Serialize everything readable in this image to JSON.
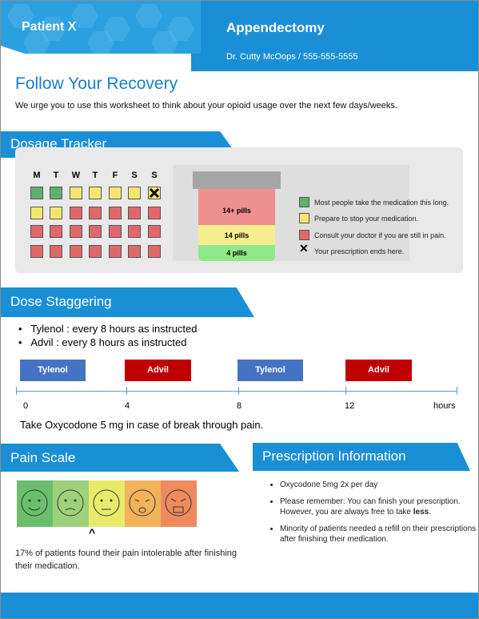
{
  "header": {
    "patient": "Patient X",
    "procedure": "Appendectomy",
    "doctor": "Dr. Cutty McOops / 555-555-5555"
  },
  "intro": {
    "title": "Follow Your Recovery",
    "text": "We urge you to use this worksheet to think about your opioid usage over the next few days/weeks."
  },
  "dosage": {
    "section_title": "Dosage Tracker",
    "days": [
      "M",
      "T",
      "W",
      "T",
      "F",
      "S",
      "S"
    ],
    "grid": [
      [
        "g",
        "g",
        "y",
        "y",
        "y",
        "y",
        "x"
      ],
      [
        "y",
        "y",
        "r",
        "r",
        "r",
        "r",
        "r"
      ],
      [
        "r",
        "r",
        "r",
        "r",
        "r",
        "r",
        "r"
      ],
      [
        "r",
        "r",
        "r",
        "r",
        "r",
        "r",
        "r"
      ]
    ],
    "bottle": {
      "top": "14+ pills",
      "middle": "14 pills",
      "bottom": "4 pills"
    },
    "legend": [
      {
        "symbol": "green",
        "text": "Most people take the medication this long."
      },
      {
        "symbol": "yellow",
        "text": "Prepare to stop your medication."
      },
      {
        "symbol": "red",
        "text": "Consult your doctor if you are still in pain."
      },
      {
        "symbol": "x",
        "text": "Your prescription ends here."
      }
    ],
    "colors": {
      "green": "#5fb06a",
      "yellow": "#f3e76f",
      "red": "#e0686b"
    }
  },
  "stagger": {
    "section_title": "Dose Staggering",
    "bullets": [
      "Tylenol : every 8 hours as instructed",
      "Advil : every 8 hours as instructed"
    ],
    "doses": [
      "Tylenol",
      "Advil",
      "Tylenol",
      "Advil"
    ],
    "ticks": [
      "0",
      "4",
      "8",
      "12"
    ],
    "unit": "hours",
    "note": "Take Oxycodone 5 mg in case of break through pain."
  },
  "pain": {
    "section_title": "Pain Scale",
    "faces": [
      "happy",
      "slight-frown",
      "neutral",
      "crying",
      "screaming"
    ],
    "face_colors": [
      "#6bbf6b",
      "#9dd17a",
      "#e9ea6a",
      "#f2b35a",
      "#ee8a5e"
    ],
    "text": "17% of patients found their pain intolerable after finishing their medication."
  },
  "rx": {
    "section_title": "Prescription Information",
    "item1": "Oxycodone 5mg 2x per day",
    "item2_a": "Please remember: You can finish your prescription. However, you are always free to take ",
    "item2_b": "less",
    "item2_c": ".",
    "item3": "Minority of patients needed a refill on their prescriptions after finishing their medication."
  }
}
